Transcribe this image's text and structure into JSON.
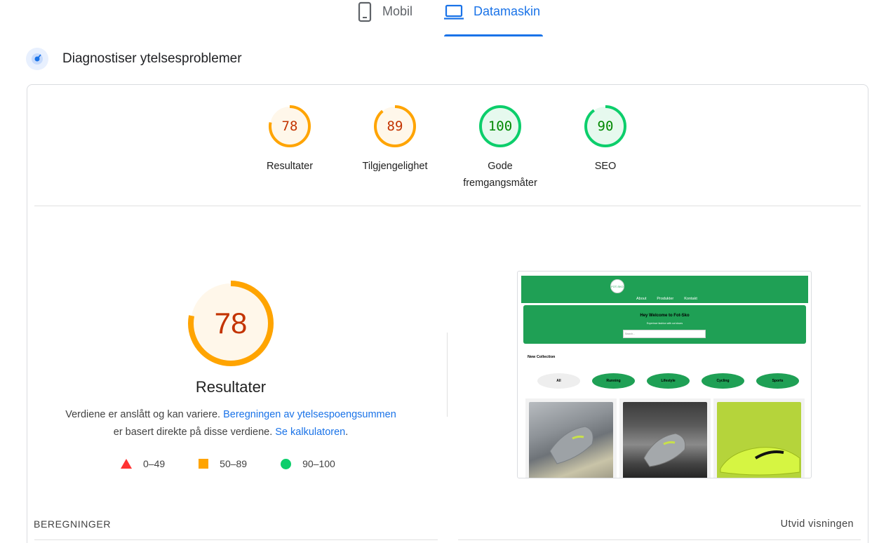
{
  "tabs": [
    {
      "label": "Mobil",
      "active": false,
      "icon": "phone-icon"
    },
    {
      "label": "Datamaskin",
      "active": true,
      "icon": "laptop-icon"
    }
  ],
  "section": {
    "title": "Diagnostiser ytelsesproblemer",
    "icon": "gauge-icon"
  },
  "scores": [
    {
      "label": "Resultater",
      "value": "78",
      "fraction": 0.78,
      "status": "average"
    },
    {
      "label": "Tilgjengelighet",
      "value": "89",
      "fraction": 0.89,
      "status": "average"
    },
    {
      "label": "Gode fremgangsmåter",
      "value": "100",
      "fraction": 1.0,
      "status": "pass"
    },
    {
      "label": "SEO",
      "value": "90",
      "fraction": 0.9,
      "status": "pass"
    }
  ],
  "colors": {
    "pass": "#0cce6b",
    "pass_text": "#008800",
    "pass_bg": "#e6f9ee",
    "average": "#ffa400",
    "average_text": "#c33300",
    "average_bg": "#fff7ea",
    "fail": "#ff3333",
    "accent": "#1a73e8"
  },
  "main_score": {
    "value": "78",
    "fraction": 0.78,
    "title": "Resultater"
  },
  "description": {
    "part1": "Verdiene er anslått og kan variere. ",
    "link1": "Beregningen av ytelsespoengsummen",
    "part2": "er basert direkte på disse verdiene. ",
    "link2": "Se kalkulatoren",
    "part3": "."
  },
  "legend": [
    {
      "range": "0–49",
      "shape": "triangle"
    },
    {
      "range": "50–89",
      "shape": "square"
    },
    {
      "range": "90–100",
      "shape": "circle"
    }
  ],
  "preview": {
    "logo": "FOT-SKO",
    "nav_links": [
      "About",
      "Produkter",
      "Kontakt"
    ],
    "hero_title": "Hey Welcome to Fot-Sko",
    "hero_sub": "Experince fashion with out shoes",
    "search_placeholder": "Search...",
    "collection_title": "New Collection",
    "categories": [
      "All",
      "Running",
      "Lifestyle",
      "Cycling",
      "Sports"
    ]
  },
  "bottom": {
    "metrics_label": "BEREGNINGER",
    "expand_label": "Utvid visningen"
  }
}
